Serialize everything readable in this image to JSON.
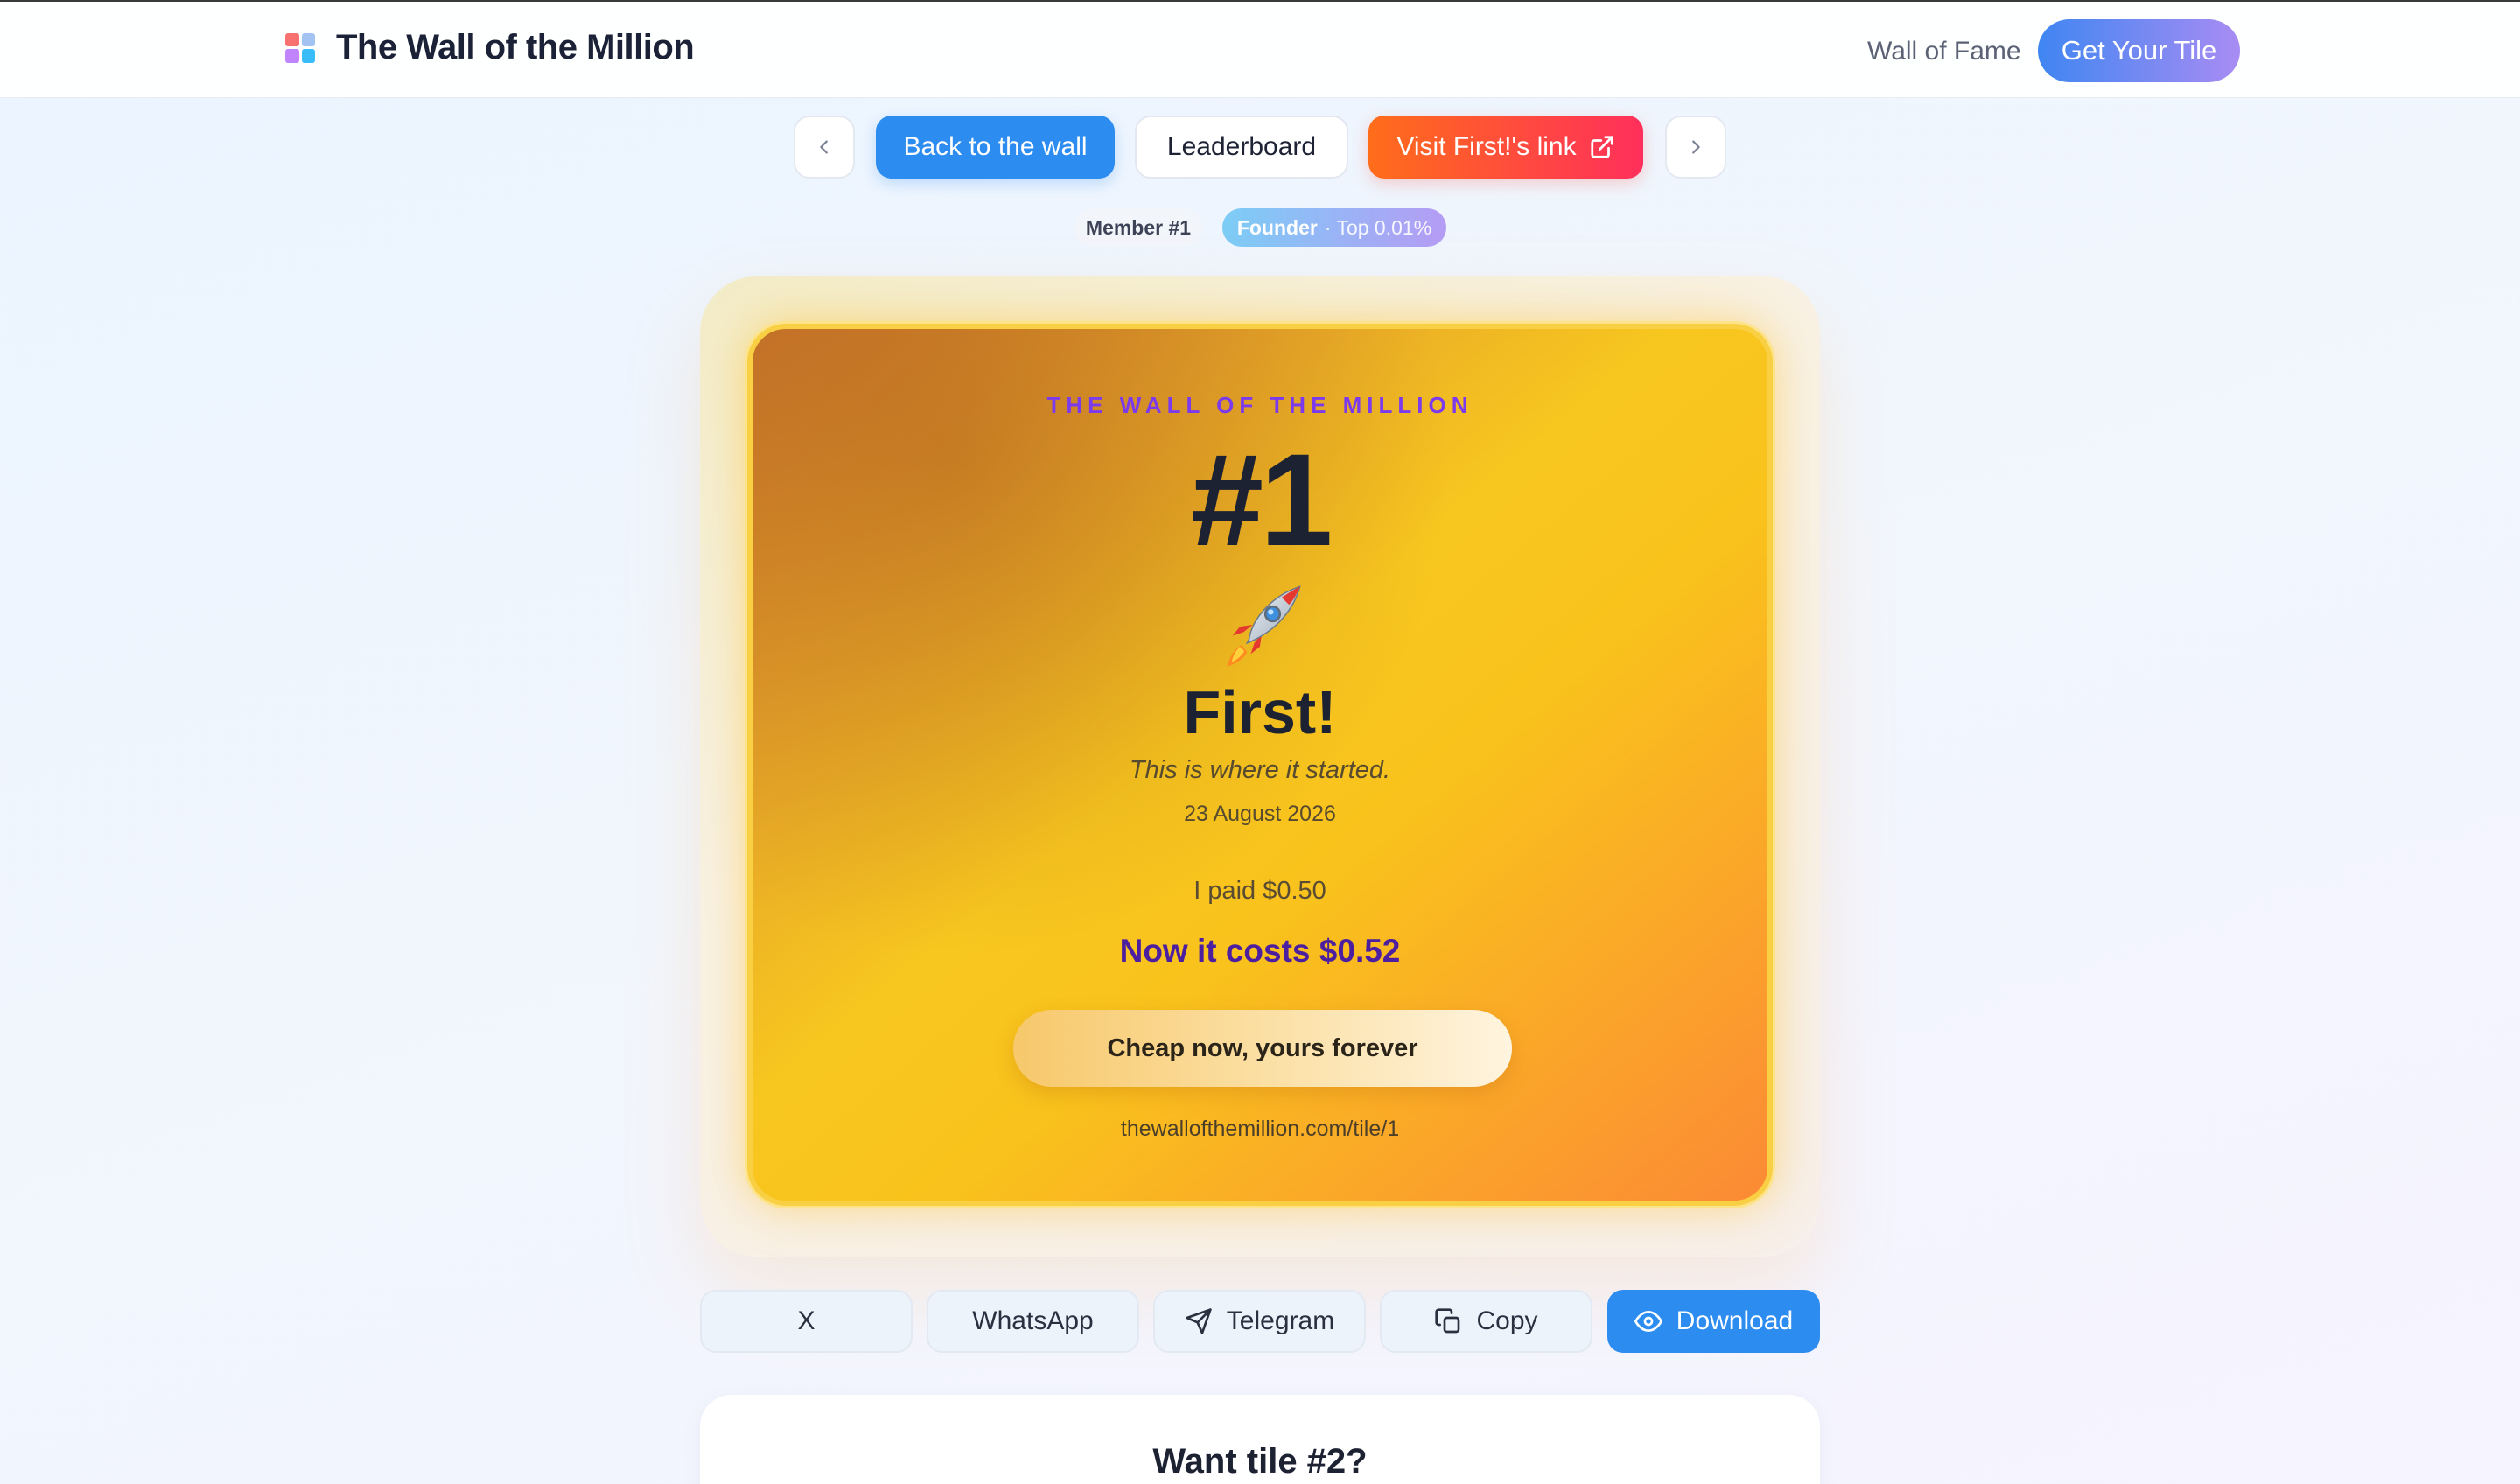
{
  "header": {
    "title": "The Wall of the Million",
    "logo_colors": [
      "#f87171",
      "#a3c4f3",
      "#c084fc",
      "#38bdf8"
    ],
    "nav_link": "Wall of Fame",
    "cta_label": "Get Your Tile"
  },
  "actions": {
    "prev_icon": "chevron-left-icon",
    "back_label": "Back to the wall",
    "leaderboard_label": "Leaderboard",
    "visit_label": "Visit First!'s link",
    "visit_icon": "external-link-icon",
    "next_icon": "chevron-right-icon"
  },
  "badges": {
    "member": "Member #1",
    "founder": "Founder",
    "founder_sub": "· Top 0.01%"
  },
  "tile": {
    "eyebrow": "THE WALL OF THE MILLION",
    "number": "#1",
    "emoji": "rocket",
    "name": "First!",
    "tagline": "This is where it started.",
    "date": "23 August 2026",
    "paid": "I paid $0.50",
    "now_costs": "Now it costs $0.52",
    "button_label": "Cheap now, yours forever",
    "url": "thewallofthemillion.com/tile/1",
    "accent_color": "#7c3aed"
  },
  "share": {
    "x": "X",
    "whatsapp": "WhatsApp",
    "telegram": "Telegram",
    "copy": "Copy",
    "download": "Download"
  },
  "promo": {
    "title": "Want tile #2?"
  }
}
